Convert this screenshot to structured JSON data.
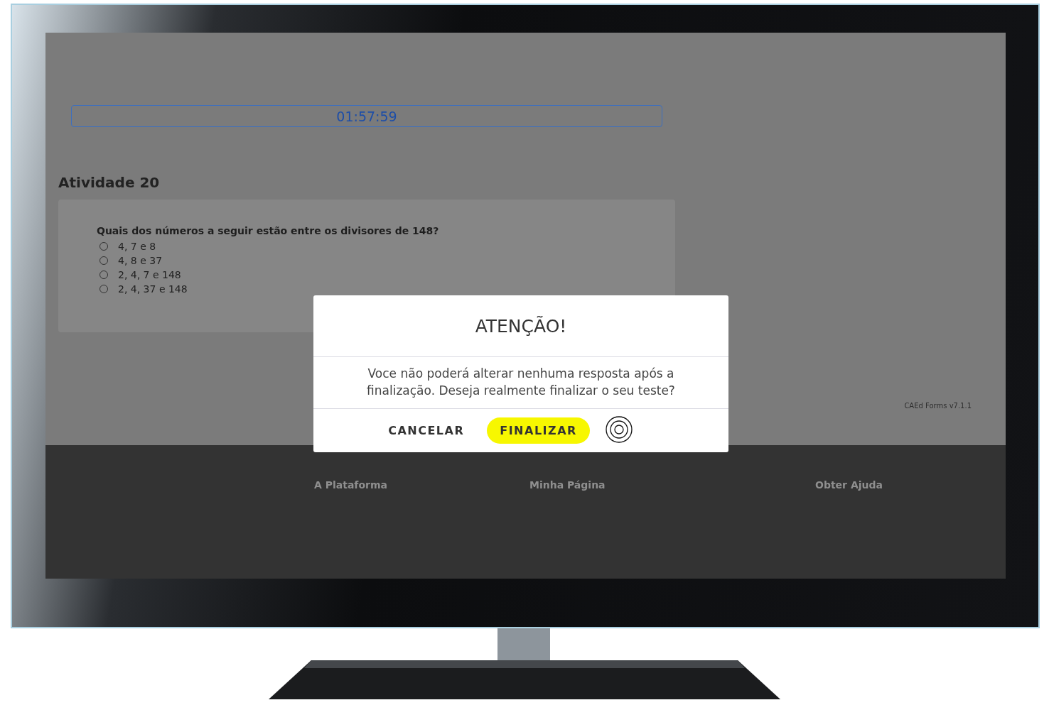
{
  "timer": "01:57:59",
  "activity": {
    "title": "Atividade 20",
    "question": "Quais dos números a seguir estão entre os divisores de 148?",
    "options": [
      {
        "label": "4, 7 e 8",
        "selected": false
      },
      {
        "label": "4, 8 e 37",
        "selected": false
      },
      {
        "label": "2, 4, 7 e 148",
        "selected": false
      },
      {
        "label": "2, 4, 37 e 148",
        "selected": false
      }
    ]
  },
  "version": "CAEd Forms v7.1.1",
  "footer_links": [
    "A Plataforma",
    "Minha Página",
    "Obter Ajuda"
  ],
  "dialog": {
    "title": "ATENÇÃO!",
    "message": "Voce não poderá alterar nenhuma resposta após a finalização. Deseja realmente finalizar o seu teste?",
    "buttons": [
      {
        "label": "CANCELAR",
        "kind": "text"
      },
      {
        "label": "FINALIZAR",
        "kind": "primary"
      }
    ]
  }
}
